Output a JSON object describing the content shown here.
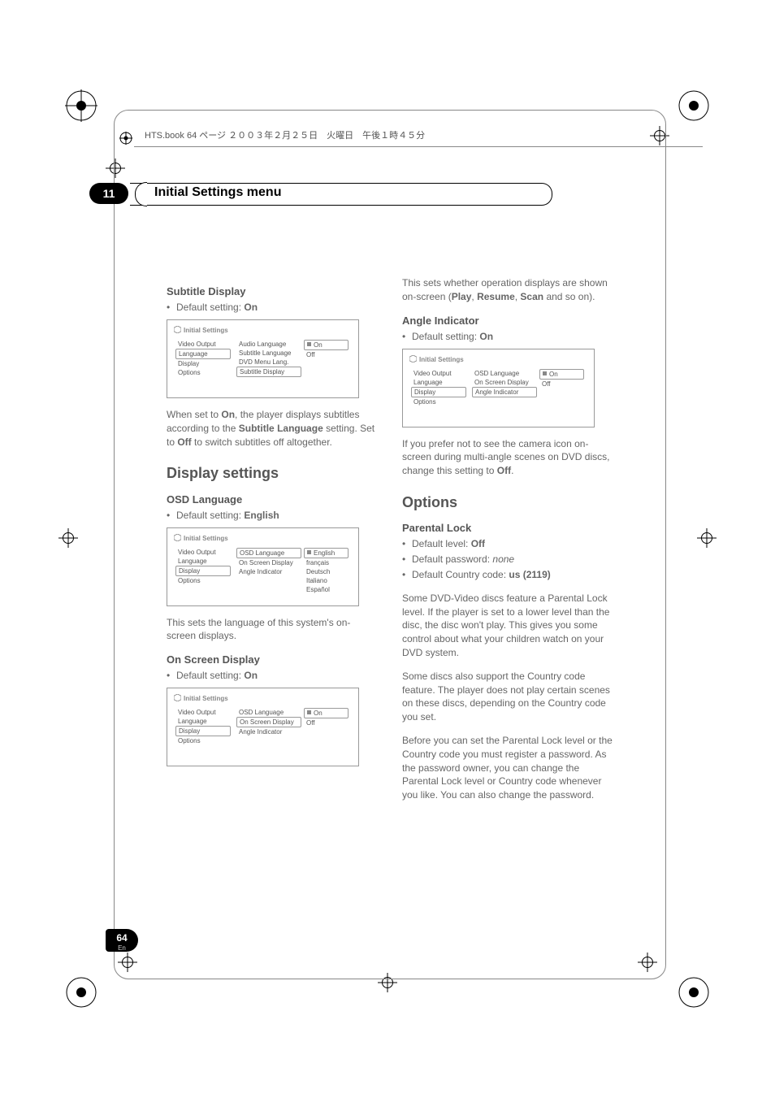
{
  "header": {
    "book_line": "HTS.book 64 ページ ２００３年２月２５日　火曜日　午後１時４５分"
  },
  "chapter": {
    "number": "11",
    "title": "Initial Settings menu"
  },
  "page": {
    "number": "64",
    "lang": "En"
  },
  "left": {
    "subtitle_display": {
      "heading": "Subtitle Display",
      "default": "Default setting: ",
      "default_val": "On",
      "diagram": {
        "title": "Initial Settings",
        "c1": [
          "Video Output",
          "Language",
          "Display",
          "Options"
        ],
        "c2": [
          "Audio Language",
          "Subtitle Language",
          "DVD Menu Lang.",
          "Subtitle Display"
        ],
        "c3": [
          "On",
          "Off"
        ],
        "c1_boxed": 1,
        "c2_boxed": 3,
        "c3_boxed": 0
      },
      "body": [
        "When set to ",
        "On",
        ", the player displays subtitles according to the ",
        "Subtitle Language",
        " setting. Set to ",
        "Off",
        " to switch subtitles off altogether."
      ]
    },
    "display_settings": {
      "heading": "Display settings",
      "osd": {
        "heading": "OSD Language",
        "default": "Default setting: ",
        "default_val": "English",
        "diagram": {
          "title": "Initial Settings",
          "c1": [
            "Video Output",
            "Language",
            "Display",
            "Options"
          ],
          "c2": [
            "OSD Language",
            "On Screen Display",
            "Angle Indicator"
          ],
          "c3": [
            "English",
            "français",
            "Deutsch",
            "Italiano",
            "Español"
          ],
          "c1_boxed": 2,
          "c2_boxed": 0,
          "c3_boxed": 0
        },
        "body": "This sets the language of this system's on-screen displays."
      },
      "osd2": {
        "heading": "On Screen Display",
        "default": "Default setting: ",
        "default_val": "On",
        "diagram": {
          "title": "Initial Settings",
          "c1": [
            "Video Output",
            "Language",
            "Display",
            "Options"
          ],
          "c2": [
            "OSD Language",
            "On Screen Display",
            "Angle Indicator"
          ],
          "c3": [
            "On",
            "Off"
          ],
          "c1_boxed": 2,
          "c2_boxed": 1,
          "c3_boxed": 0
        }
      }
    }
  },
  "right": {
    "osd_body": [
      "This sets whether operation displays are shown on-screen (",
      "Play",
      ", ",
      "Resume",
      ", ",
      "Scan",
      " and so on)."
    ],
    "angle": {
      "heading": "Angle Indicator",
      "default": "Default setting: ",
      "default_val": "On",
      "diagram": {
        "title": "Initial Settings",
        "c1": [
          "Video Output",
          "Language",
          "Display",
          "Options"
        ],
        "c2": [
          "OSD Language",
          "On Screen Display",
          "Angle Indicator"
        ],
        "c3": [
          "On",
          "Off"
        ],
        "c1_boxed": 2,
        "c2_boxed": 2,
        "c3_boxed": 0
      },
      "body": [
        "If you prefer not to see the camera icon on-screen during multi-angle scenes on DVD discs, change this setting to ",
        "Off",
        "."
      ]
    },
    "options": {
      "heading": "Options",
      "parental": {
        "heading": "Parental Lock",
        "lines": [
          {
            "pre": "Default level: ",
            "bold": "Off"
          },
          {
            "pre": "Default password: ",
            "italic": "none"
          },
          {
            "pre": "Default Country code: ",
            "bold": "us (2119)"
          }
        ],
        "p1": "Some DVD-Video discs feature a Parental Lock level. If the player is set to a lower level than the disc, the disc won't play. This gives you some control about what your children watch on your DVD system.",
        "p2": "Some discs also support the Country code feature. The player does not play certain scenes on these discs, depending on the Country code you set.",
        "p3": "Before you can set the Parental Lock level or the Country code you must register a password. As the password owner, you can change the Parental Lock level or Country code whenever you like. You can also change the password."
      }
    }
  }
}
